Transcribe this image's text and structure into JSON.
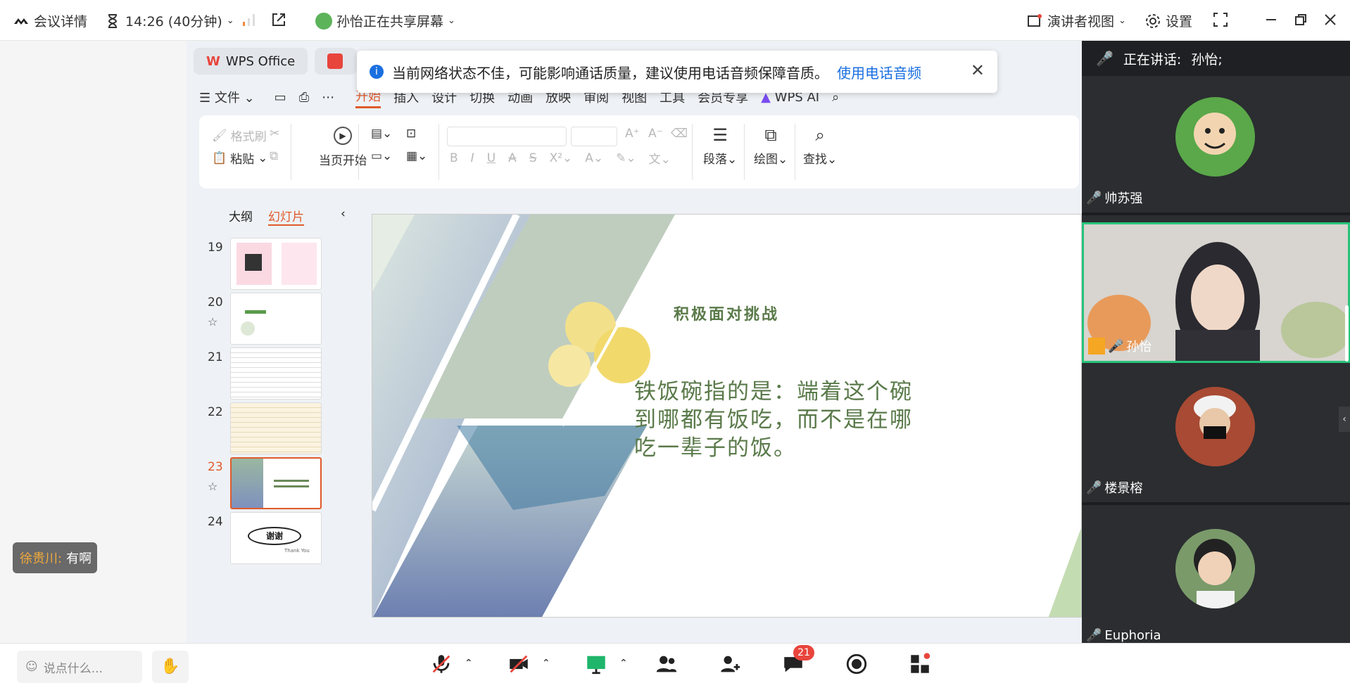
{
  "topbar": {
    "meeting_details": "会议详情",
    "timer": "14:26 (40分钟)",
    "sharing": "孙怡正在共享屏幕",
    "presenter_view": "演讲者视图",
    "settings": "设置"
  },
  "chat_toast": {
    "name": "徐贵川:",
    "message": "有啊"
  },
  "wps": {
    "tabs": [
      "WPS Office"
    ],
    "menu": {
      "file": "文件",
      "items": [
        "开始",
        "插入",
        "设计",
        "切换",
        "动画",
        "放映",
        "审阅",
        "视图",
        "工具",
        "会员专享"
      ],
      "ai": "WPS AI"
    },
    "ribbon": {
      "format_painter": "格式刷",
      "paste": "粘贴",
      "from_current": "当页开始",
      "paragraph": "段落",
      "drawing": "绘图",
      "find": "查找"
    },
    "panel": {
      "outline": "大纲",
      "slides": "幻灯片"
    },
    "thumbnails": [
      {
        "num": "19"
      },
      {
        "num": "20"
      },
      {
        "num": "21"
      },
      {
        "num": "22"
      },
      {
        "num": "23"
      },
      {
        "num": "24",
        "text": "谢谢",
        "sub": "Thank You"
      }
    ],
    "slide": {
      "heading": "积极面对挑战",
      "body": "铁饭碗指的是：端着这个碗到哪都有饭吃，而不是在哪吃一辈子的饭。"
    }
  },
  "notice": {
    "text": "当前网络状态不佳，可能影响通话质量，建议使用电话音频保障音质。",
    "link": "使用电话音频"
  },
  "speaker": {
    "label": "正在讲话:",
    "name": "孙怡;"
  },
  "participants": [
    {
      "name": "帅苏强"
    },
    {
      "name": "孙怡"
    },
    {
      "name": "楼景榕"
    },
    {
      "name": "Euphoria"
    }
  ],
  "bottombar": {
    "chat_placeholder": "说点什么...",
    "chat_badge": "21"
  },
  "colors": {
    "accent": "#e05a2b",
    "link": "#1a6fe0",
    "active_tile": "#27c37a",
    "slide_green": "#5a7a4a"
  }
}
